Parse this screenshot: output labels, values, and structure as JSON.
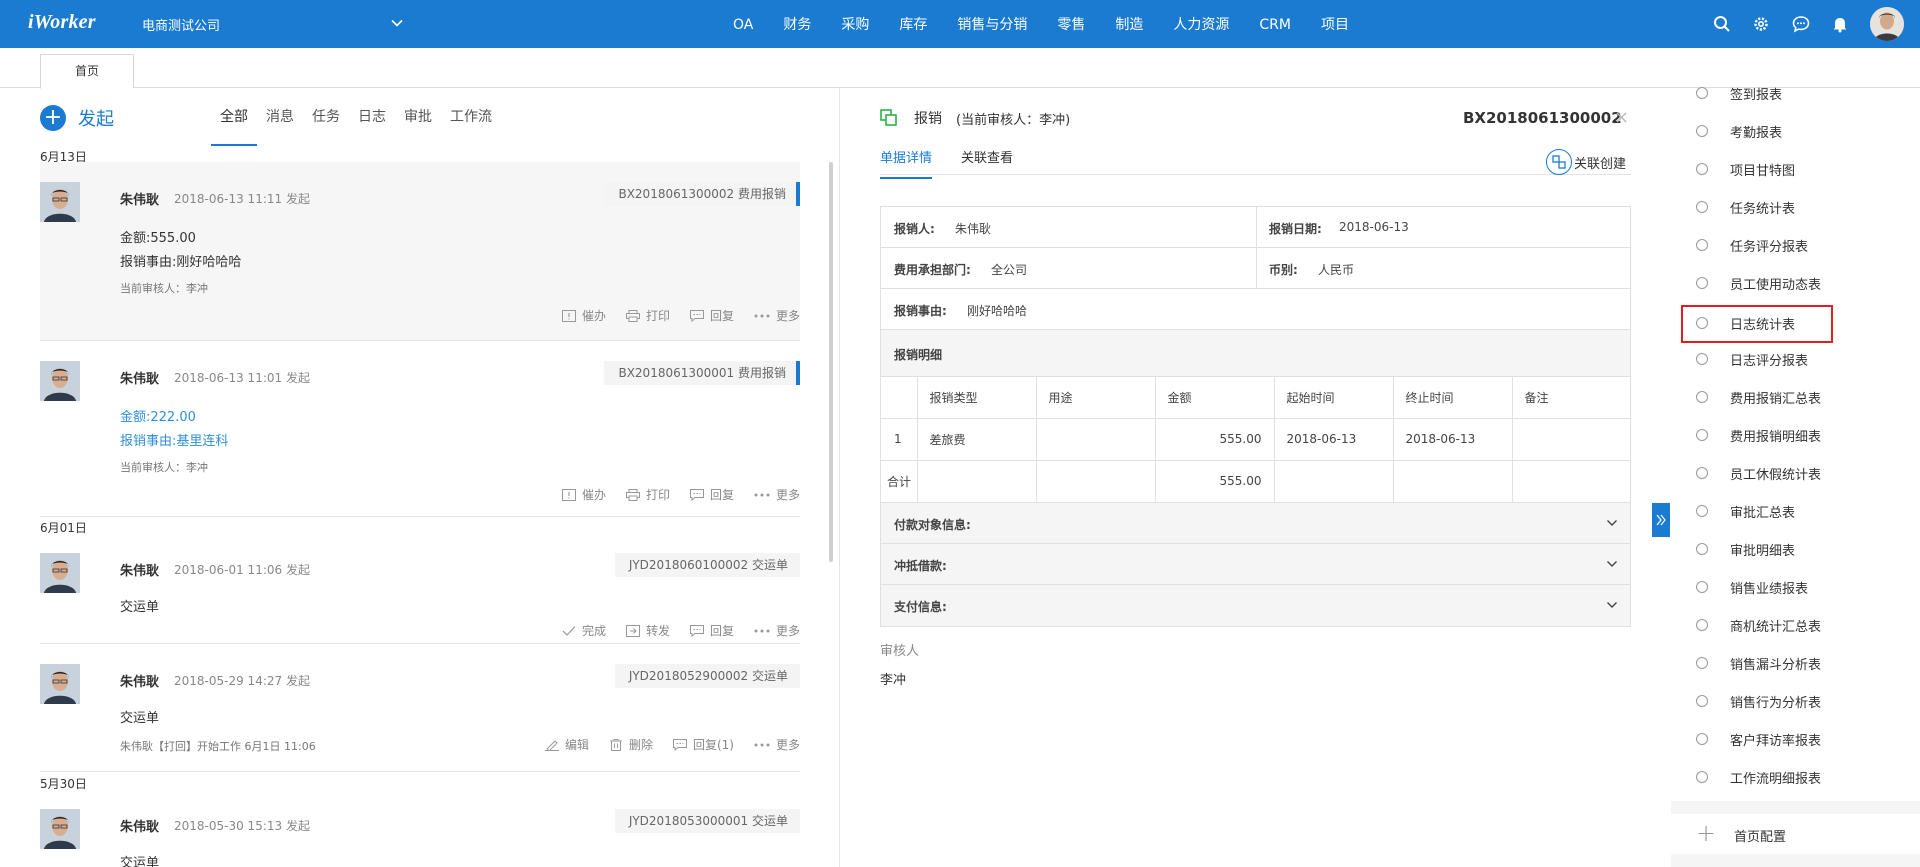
{
  "app": {
    "logo": "iWorker",
    "company": "电商测试公司"
  },
  "nav": [
    "OA",
    "财务",
    "采购",
    "库存",
    "销售与分销",
    "零售",
    "制造",
    "人力资源",
    "CRM",
    "项目"
  ],
  "tabs": {
    "home": "首页"
  },
  "left": {
    "start_label": "发起",
    "filters": [
      "全部",
      "消息",
      "任务",
      "日志",
      "审批",
      "工作流"
    ],
    "dates": [
      "6月13日",
      "6月01日",
      "5月30日"
    ],
    "cards": [
      {
        "name": "朱伟耿",
        "time": "2018-06-13 11:11 发起",
        "code": "BX2018061300002 费用报销",
        "lines": [
          "金额:555.00",
          "报销事由:刚好哈哈哈"
        ],
        "reviewer": "当前审核人：李冲",
        "actions": [
          "催办",
          "打印",
          "回复",
          "更多"
        ]
      },
      {
        "name": "朱伟耿",
        "time": "2018-06-13 11:01 发起",
        "code": "BX2018061300001 费用报销",
        "lines": [
          "金额:222.00",
          "报销事由:基里连科"
        ],
        "reviewer": "当前审核人：李冲",
        "actions": [
          "催办",
          "打印",
          "回复",
          "更多"
        ]
      },
      {
        "name": "朱伟耿",
        "time": "2018-06-01 11:06 发起",
        "code": "JYD2018060100002 交运单",
        "lines": [
          "交运单"
        ],
        "actions": [
          "完成",
          "转发",
          "回复",
          "更多"
        ]
      },
      {
        "name": "朱伟耿",
        "time": "2018-05-29 14:27 发起",
        "code": "JYD2018052900002 交运单",
        "lines": [
          "交运单"
        ],
        "reviewer": "朱伟耿【打回】开始工作  6月1日 11:06",
        "actions": [
          "编辑",
          "删除",
          "回复(1)",
          "更多"
        ]
      },
      {
        "name": "朱伟耿",
        "time": "2018-05-30 15:13 发起",
        "code": "JYD2018053000001 交运单",
        "lines": [
          "交运单"
        ]
      }
    ]
  },
  "detail": {
    "title": "报销",
    "subtitle": "(当前审核人：李冲)",
    "code": "BX2018061300002",
    "close": "×",
    "tabs": [
      "单据详情",
      "关联查看"
    ],
    "relate_create": "关联创建",
    "fields": {
      "applicant_label": "报销人:",
      "applicant": "朱伟耿",
      "date_label": "报销日期:",
      "date": "2018-06-13",
      "dept_label": "费用承担部门:",
      "dept": "全公司",
      "currency_label": "币别:",
      "currency": "人民币",
      "reason_label": "报销事由:",
      "reason": "刚好哈哈哈"
    },
    "detail_section": "报销明细",
    "table_headers": [
      "",
      "报销类型",
      "用途",
      "金额",
      "起始时间",
      "终止时间",
      "备注"
    ],
    "rows": [
      [
        "1",
        "差旅费",
        "",
        "555.00",
        "2018-06-13",
        "2018-06-13",
        ""
      ]
    ],
    "total_row": [
      "合计",
      "",
      "",
      "555.00",
      "",
      "",
      ""
    ],
    "collapsibles": [
      "付款对象信息:",
      "冲抵借款:",
      "支付信息:"
    ],
    "reviewer_label": "审核人",
    "reviewer": "李冲"
  },
  "reports": {
    "items": [
      "签到报表",
      "考勤报表",
      "项目甘特图",
      "任务统计表",
      "任务评分报表",
      "员工使用动态表",
      "日志统计表",
      "日志评分报表",
      "费用报销汇总表",
      "费用报销明细表",
      "员工休假统计表",
      "审批汇总表",
      "审批明细表",
      "销售业绩报表",
      "商机统计汇总表",
      "销售漏斗分析表",
      "销售行为分析表",
      "客户拜访率报表",
      "工作流明细报表"
    ],
    "selected": "日志统计表",
    "config": "首页配置"
  },
  "colors": {
    "primary": "#1a7bd1",
    "highlight": "#e02020",
    "link": "#2f8fd8"
  }
}
